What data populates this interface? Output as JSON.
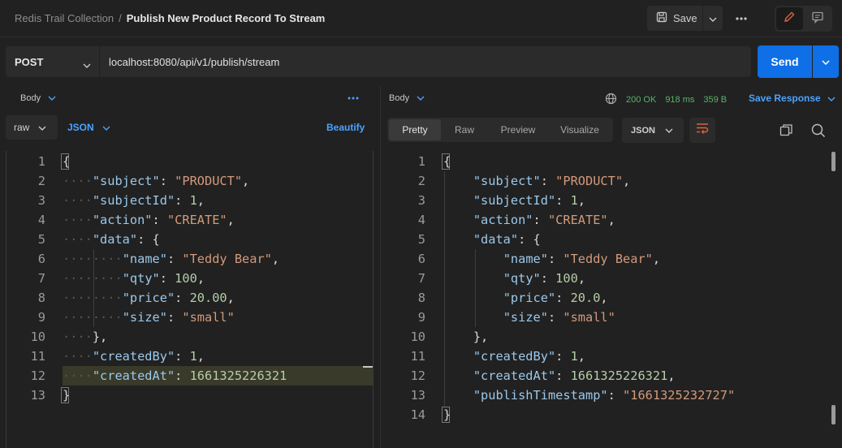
{
  "breadcrumb": {
    "collection": "Redis Trail Collection",
    "separator": "/",
    "request": "Publish New Product Record To Stream"
  },
  "toolbar": {
    "save_label": "Save"
  },
  "request": {
    "method": "POST",
    "url": "localhost:8080/api/v1/publish/stream",
    "send_label": "Send",
    "body_tab": "Body",
    "body_mode": "raw",
    "body_lang": "JSON",
    "beautify_label": "Beautify",
    "line_numbers": [
      "1",
      "2",
      "3",
      "4",
      "5",
      "6",
      "7",
      "8",
      "9",
      "10",
      "11",
      "12",
      "13"
    ]
  },
  "response": {
    "body_tab": "Body",
    "status": "200 OK",
    "time": "918 ms",
    "size": "359 B",
    "save_response_label": "Save Response",
    "view_tabs": [
      "Pretty",
      "Raw",
      "Preview",
      "Visualize"
    ],
    "format": "JSON",
    "line_numbers": [
      "1",
      "2",
      "3",
      "4",
      "5",
      "6",
      "7",
      "8",
      "9",
      "10",
      "11",
      "12",
      "13",
      "14"
    ]
  },
  "colors": {
    "accent": "#0f6fe6",
    "link": "#4aa3ff",
    "status_ok": "#57b36a",
    "key": "#9bc8ea",
    "string": "#d39a7b",
    "number": "#b5cea8"
  }
}
